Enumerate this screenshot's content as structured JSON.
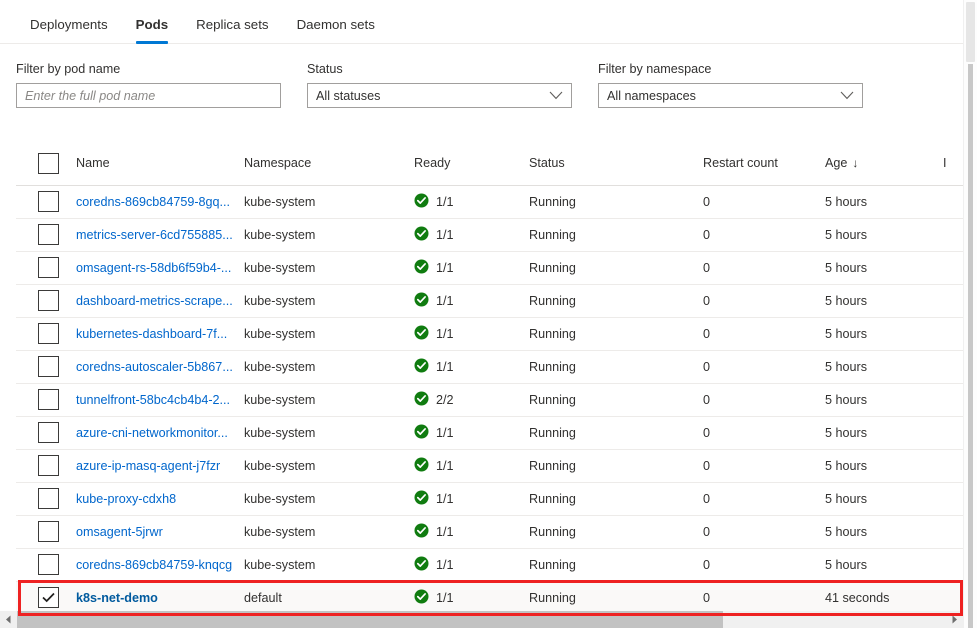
{
  "tabs": [
    {
      "label": "Deployments",
      "active": false
    },
    {
      "label": "Pods",
      "active": true
    },
    {
      "label": "Replica sets",
      "active": false
    },
    {
      "label": "Daemon sets",
      "active": false
    }
  ],
  "filters": {
    "pod_name": {
      "label": "Filter by pod name",
      "placeholder": "Enter the full pod name",
      "value": ""
    },
    "status": {
      "label": "Status",
      "value": "All statuses",
      "icon": "chevron-down-icon"
    },
    "namespace": {
      "label": "Filter by namespace",
      "value": "All namespaces",
      "icon": "chevron-down-icon"
    }
  },
  "table": {
    "columns": [
      {
        "key": "check",
        "label": ""
      },
      {
        "key": "name",
        "label": "Name"
      },
      {
        "key": "ns",
        "label": "Namespace"
      },
      {
        "key": "ready",
        "label": "Ready"
      },
      {
        "key": "status",
        "label": "Status"
      },
      {
        "key": "restart",
        "label": "Restart count"
      },
      {
        "key": "age",
        "label": "Age"
      },
      {
        "key": "extra",
        "label": "I"
      }
    ],
    "sort": {
      "column": "Age",
      "direction": "descending",
      "arrow": "↓"
    },
    "header_checkbox_checked": false,
    "rows": [
      {
        "checked": false,
        "name": "coredns-869cb84759-8gq...",
        "namespace": "kube-system",
        "ready": "1/1",
        "ready_icon": "success-check-icon",
        "status": "Running",
        "restart_count": "0",
        "age": "5 hours"
      },
      {
        "checked": false,
        "name": "metrics-server-6cd755885...",
        "namespace": "kube-system",
        "ready": "1/1",
        "ready_icon": "success-check-icon",
        "status": "Running",
        "restart_count": "0",
        "age": "5 hours"
      },
      {
        "checked": false,
        "name": "omsagent-rs-58db6f59b4-...",
        "namespace": "kube-system",
        "ready": "1/1",
        "ready_icon": "success-check-icon",
        "status": "Running",
        "restart_count": "0",
        "age": "5 hours"
      },
      {
        "checked": false,
        "name": "dashboard-metrics-scrape...",
        "namespace": "kube-system",
        "ready": "1/1",
        "ready_icon": "success-check-icon",
        "status": "Running",
        "restart_count": "0",
        "age": "5 hours"
      },
      {
        "checked": false,
        "name": "kubernetes-dashboard-7f...",
        "namespace": "kube-system",
        "ready": "1/1",
        "ready_icon": "success-check-icon",
        "status": "Running",
        "restart_count": "0",
        "age": "5 hours"
      },
      {
        "checked": false,
        "name": "coredns-autoscaler-5b867...",
        "namespace": "kube-system",
        "ready": "1/1",
        "ready_icon": "success-check-icon",
        "status": "Running",
        "restart_count": "0",
        "age": "5 hours"
      },
      {
        "checked": false,
        "name": "tunnelfront-58bc4cb4b4-2...",
        "namespace": "kube-system",
        "ready": "2/2",
        "ready_icon": "success-check-icon",
        "status": "Running",
        "restart_count": "0",
        "age": "5 hours"
      },
      {
        "checked": false,
        "name": "azure-cni-networkmonitor...",
        "namespace": "kube-system",
        "ready": "1/1",
        "ready_icon": "success-check-icon",
        "status": "Running",
        "restart_count": "0",
        "age": "5 hours"
      },
      {
        "checked": false,
        "name": "azure-ip-masq-agent-j7fzr",
        "namespace": "kube-system",
        "ready": "1/1",
        "ready_icon": "success-check-icon",
        "status": "Running",
        "restart_count": "0",
        "age": "5 hours"
      },
      {
        "checked": false,
        "name": "kube-proxy-cdxh8",
        "namespace": "kube-system",
        "ready": "1/1",
        "ready_icon": "success-check-icon",
        "status": "Running",
        "restart_count": "0",
        "age": "5 hours"
      },
      {
        "checked": false,
        "name": "omsagent-5jrwr",
        "namespace": "kube-system",
        "ready": "1/1",
        "ready_icon": "success-check-icon",
        "status": "Running",
        "restart_count": "0",
        "age": "5 hours"
      },
      {
        "checked": false,
        "name": "coredns-869cb84759-knqcg",
        "namespace": "kube-system",
        "ready": "1/1",
        "ready_icon": "success-check-icon",
        "status": "Running",
        "restart_count": "0",
        "age": "5 hours"
      },
      {
        "checked": true,
        "name": "k8s-net-demo",
        "namespace": "default",
        "ready": "1/1",
        "ready_icon": "success-check-icon",
        "status": "Running",
        "restart_count": "0",
        "age": "41 seconds"
      }
    ]
  },
  "colors": {
    "accent": "#0078d4",
    "link": "#0066cc",
    "success": "#107c10",
    "annotation": "#ee2222",
    "row_selected_bg": "#faf9f8",
    "border": "#edebe9"
  }
}
